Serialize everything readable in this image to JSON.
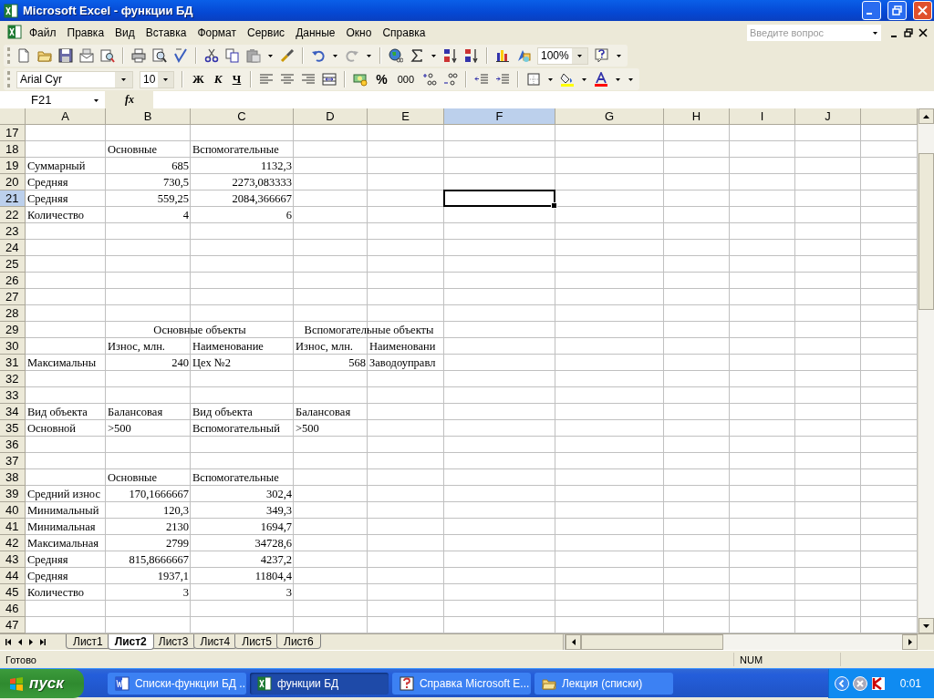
{
  "window": {
    "title": "Microsoft Excel - функции БД"
  },
  "menu": [
    "Файл",
    "Правка",
    "Вид",
    "Вставка",
    "Формат",
    "Сервис",
    "Данные",
    "Окно",
    "Справка"
  ],
  "help_box": {
    "placeholder": "Введите вопрос"
  },
  "standard_toolbar": {
    "zoom": "100%"
  },
  "formatting_toolbar": {
    "font": "Arial Cyr",
    "size": "10",
    "bold": "Ж",
    "italic": "К",
    "underline": "Ч",
    "percent": "%",
    "thousands": "000"
  },
  "formula_bar": {
    "name_box": "F21",
    "function_label": "fx"
  },
  "sheet": {
    "columns": [
      {
        "label": "A",
        "selected": false
      },
      {
        "label": "B",
        "selected": false
      },
      {
        "label": "C",
        "selected": false
      },
      {
        "label": "D",
        "selected": false
      },
      {
        "label": "E",
        "selected": false
      },
      {
        "label": "F",
        "selected": true
      },
      {
        "label": "G",
        "selected": false
      },
      {
        "label": "H",
        "selected": false
      },
      {
        "label": "I",
        "selected": false
      },
      {
        "label": "J",
        "selected": false
      }
    ],
    "rows": [
      {
        "number": "17",
        "selected": false
      },
      {
        "number": "18",
        "selected": false,
        "cells": [
          null,
          {
            "text": "Основные",
            "kind": "text"
          },
          {
            "text": "Вспомогательные",
            "kind": "text"
          }
        ]
      },
      {
        "number": "19",
        "selected": false,
        "cells": [
          {
            "text": "Суммарный",
            "kind": "text"
          },
          {
            "text": "685",
            "kind": "number"
          },
          {
            "text": "1132,3",
            "kind": "number"
          }
        ]
      },
      {
        "number": "20",
        "selected": false,
        "cells": [
          {
            "text": "Средняя",
            "kind": "text"
          },
          {
            "text": "730,5",
            "kind": "number"
          },
          {
            "text": "2273,083333",
            "kind": "number"
          }
        ]
      },
      {
        "number": "21",
        "selected": true,
        "cells": [
          {
            "text": "Средняя",
            "kind": "text"
          },
          {
            "text": "559,25",
            "kind": "number"
          },
          {
            "text": "2084,366667",
            "kind": "number"
          }
        ]
      },
      {
        "number": "22",
        "selected": false,
        "cells": [
          {
            "text": "Количество",
            "kind": "text"
          },
          {
            "text": "4",
            "kind": "number"
          },
          {
            "text": "6",
            "kind": "number"
          }
        ]
      },
      {
        "number": "23",
        "selected": false
      },
      {
        "number": "24",
        "selected": false
      },
      {
        "number": "25",
        "selected": false
      },
      {
        "number": "26",
        "selected": false
      },
      {
        "number": "27",
        "selected": false
      },
      {
        "number": "28",
        "selected": false
      },
      {
        "number": "29",
        "selected": false,
        "cells": [
          null,
          {
            "text": "Основные объекты",
            "kind": "merged"
          },
          {
            "text": "Вспомогательные объекты",
            "kind": "merged"
          }
        ]
      },
      {
        "number": "30",
        "selected": false,
        "cells": [
          null,
          {
            "text": "Износ, млн.",
            "kind": "text"
          },
          {
            "text": "Наименование",
            "kind": "text"
          },
          {
            "text": "Износ, млн.",
            "kind": "text"
          },
          {
            "text": "Наименовани",
            "kind": "text"
          }
        ]
      },
      {
        "number": "31",
        "selected": false,
        "cells": [
          {
            "text": "Максимальны",
            "kind": "text"
          },
          {
            "text": "240",
            "kind": "number"
          },
          {
            "text": "Цех №2",
            "kind": "text"
          },
          {
            "text": "568",
            "kind": "number"
          },
          {
            "text": "Заводоуправл",
            "kind": "text"
          }
        ]
      },
      {
        "number": "32",
        "selected": false
      },
      {
        "number": "33",
        "selected": false
      },
      {
        "number": "34",
        "selected": false,
        "cells": [
          {
            "text": "Вид объекта",
            "kind": "text"
          },
          {
            "text": "Балансовая",
            "kind": "text"
          },
          {
            "text": "Вид объекта",
            "kind": "text"
          },
          {
            "text": "Балансовая",
            "kind": "text"
          }
        ]
      },
      {
        "number": "35",
        "selected": false,
        "cells": [
          {
            "text": "Основной",
            "kind": "text"
          },
          {
            "text": ">500",
            "kind": "text"
          },
          {
            "text": "Вспомогательный",
            "kind": "text"
          },
          {
            "text": ">500",
            "kind": "text"
          }
        ]
      },
      {
        "number": "36",
        "selected": false
      },
      {
        "number": "37",
        "selected": false
      },
      {
        "number": "38",
        "selected": false,
        "cells": [
          null,
          {
            "text": "Основные",
            "kind": "text"
          },
          {
            "text": "Вспомогательные",
            "kind": "text"
          }
        ]
      },
      {
        "number": "39",
        "selected": false,
        "cells": [
          {
            "text": "Средний износ",
            "kind": "text"
          },
          {
            "text": "170,1666667",
            "kind": "number"
          },
          {
            "text": "302,4",
            "kind": "number"
          }
        ]
      },
      {
        "number": "40",
        "selected": false,
        "cells": [
          {
            "text": "Минимальный",
            "kind": "text"
          },
          {
            "text": "120,3",
            "kind": "number"
          },
          {
            "text": "349,3",
            "kind": "number"
          }
        ]
      },
      {
        "number": "41",
        "selected": false,
        "cells": [
          {
            "text": "Минимальная",
            "kind": "text"
          },
          {
            "text": "2130",
            "kind": "number"
          },
          {
            "text": "1694,7",
            "kind": "number"
          }
        ]
      },
      {
        "number": "42",
        "selected": false,
        "cells": [
          {
            "text": "Максимальная",
            "kind": "text"
          },
          {
            "text": "2799",
            "kind": "number"
          },
          {
            "text": "34728,6",
            "kind": "number"
          }
        ]
      },
      {
        "number": "43",
        "selected": false,
        "cells": [
          {
            "text": "Средняя",
            "kind": "text"
          },
          {
            "text": "815,8666667",
            "kind": "number"
          },
          {
            "text": "4237,2",
            "kind": "number"
          }
        ]
      },
      {
        "number": "44",
        "selected": false,
        "cells": [
          {
            "text": "Средняя",
            "kind": "text"
          },
          {
            "text": "1937,1",
            "kind": "number"
          },
          {
            "text": "11804,4",
            "kind": "number"
          }
        ]
      },
      {
        "number": "45",
        "selected": false,
        "cells": [
          {
            "text": "Количество",
            "kind": "text"
          },
          {
            "text": "3",
            "kind": "number"
          },
          {
            "text": "3",
            "kind": "number"
          }
        ]
      },
      {
        "number": "46",
        "selected": false
      },
      {
        "number": "47",
        "selected": false
      }
    ]
  },
  "sheet_tabs": [
    {
      "label": "Лист1",
      "selected": false
    },
    {
      "label": "Лист2",
      "selected": true
    },
    {
      "label": "Лист3",
      "selected": false
    },
    {
      "label": "Лист4",
      "selected": false
    },
    {
      "label": "Лист5",
      "selected": false
    },
    {
      "label": "Лист6",
      "selected": false
    }
  ],
  "status_bar": {
    "status": "Готово",
    "num_lock": "NUM"
  },
  "taskbar": {
    "start": "пуск",
    "items": [
      {
        "label": "Списки-функции БД ...",
        "kind": "word",
        "selected": false
      },
      {
        "label": "функции БД",
        "kind": "excel",
        "selected": true
      },
      {
        "label": "Справка Microsoft E...",
        "kind": "help",
        "selected": false
      },
      {
        "label": "Лекция (списки)",
        "kind": "folder",
        "selected": false
      }
    ],
    "clock": "0:01"
  }
}
